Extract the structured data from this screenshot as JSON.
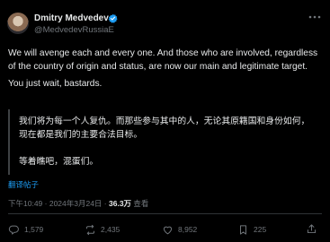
{
  "author": {
    "name": "Dmitry Medvedev",
    "handle": "@MedvedevRussiaE"
  },
  "post": {
    "paragraph_1": "We will avenge each and every one. And those who are involved, regardless of the country of origin and status, are now our main and legitimate target.",
    "paragraph_2": "You just wait, bastards."
  },
  "translation": {
    "paragraph_1": "我们将为每一个人复仇。而那些参与其中的人，无论其原籍国和身份如何，现在都是我们的主要合法目标。",
    "paragraph_2": "等着瞧吧，混蛋们。"
  },
  "translate_label": "翻译帖子",
  "meta": {
    "time": "下午10:49",
    "separator": " · ",
    "date": "2024年3月24日",
    "views_count": "36.3万",
    "views_label": " 查看"
  },
  "actions": {
    "replies": "1,579",
    "reposts": "2,435",
    "likes": "8,952",
    "bookmarks": "225"
  },
  "colors": {
    "background": "#000000",
    "text": "#e7e9ea",
    "muted": "#71767b",
    "accent": "#1d9bf0"
  },
  "icons": {
    "verified": "verified-badge-icon",
    "more": "more-icon",
    "reply": "reply-icon",
    "repost": "repost-icon",
    "like": "like-icon",
    "bookmark": "bookmark-icon"
  }
}
